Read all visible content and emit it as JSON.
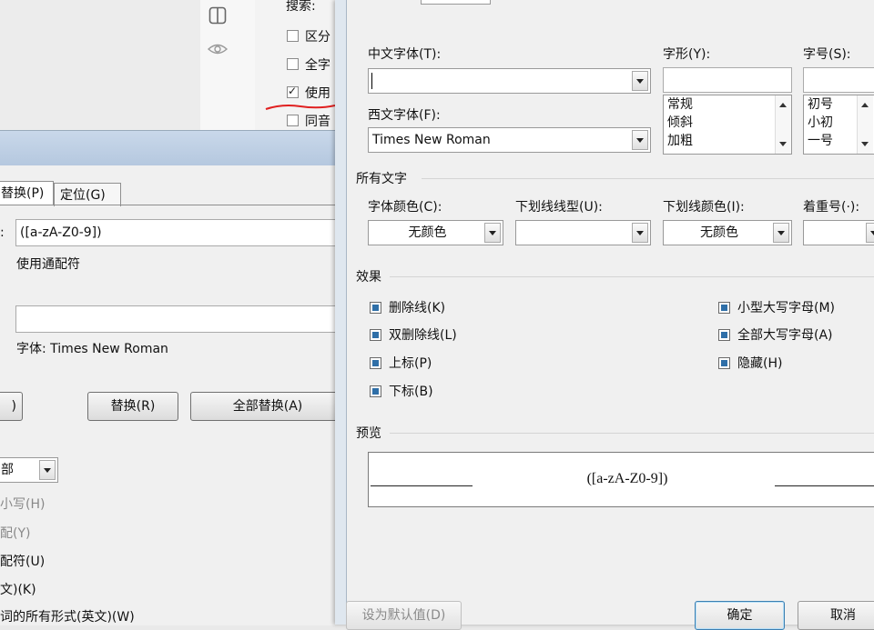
{
  "find_panel": {
    "search_label": "搜索:",
    "options": [
      {
        "label": "区分",
        "checked": false
      },
      {
        "label": "全字",
        "checked": false
      },
      {
        "label": "使用",
        "checked": true
      },
      {
        "label": "同音",
        "checked": false
      }
    ],
    "annotation_color": "#e02020"
  },
  "find_replace": {
    "tabs": [
      "替换(P)",
      "定位(G)"
    ],
    "find_label": ":",
    "find_value": "([a-zA-Z0-9])",
    "find_format": "使用通配符",
    "replace_value": "",
    "replace_format": "字体: Times New Roman",
    "buttons": {
      "left_partial": ")",
      "replace": "替换(R)",
      "replace_all": "全部替换(A)"
    },
    "search_scope": "部",
    "options": [
      {
        "label": "小写(H)",
        "dim": true
      },
      {
        "label": "配(Y)",
        "dim": true
      },
      {
        "label": "配符(U)",
        "dim": false
      },
      {
        "label": "文)(K)",
        "dim": false
      },
      {
        "label": "词的所有形式(英文)(W)",
        "dim": false
      }
    ]
  },
  "font_dialog": {
    "chinese_font_label": "中文字体(T):",
    "chinese_font_value": "",
    "western_font_label": "西文字体(F):",
    "western_font_value": "Times New Roman",
    "style_label": "字形(Y):",
    "style_value": "",
    "style_items": [
      "常规",
      "倾斜",
      "加粗"
    ],
    "size_label": "字号(S):",
    "size_value": "",
    "size_items": [
      "初号",
      "小初",
      "一号"
    ],
    "all_text_section": "所有文字",
    "font_color_label": "字体颜色(C):",
    "font_color_value": "无颜色",
    "underline_style_label": "下划线线型(U):",
    "underline_style_value": "",
    "underline_color_label": "下划线颜色(I):",
    "underline_color_value": "无颜色",
    "emphasis_label": "着重号(·):",
    "emphasis_value": "",
    "effects_section": "效果",
    "effects_left": [
      "删除线(K)",
      "双删除线(L)",
      "上标(P)",
      "下标(B)"
    ],
    "effects_right": [
      "小型大写字母(M)",
      "全部大写字母(A)",
      "隐藏(H)"
    ],
    "effect_fill_color": "#2f6fa8",
    "preview_section": "预览",
    "preview_text": "([a-zA-Z0-9])",
    "buttons": {
      "set_default": "设为默认值(D)",
      "ok": "确定",
      "cancel": "取消"
    }
  }
}
